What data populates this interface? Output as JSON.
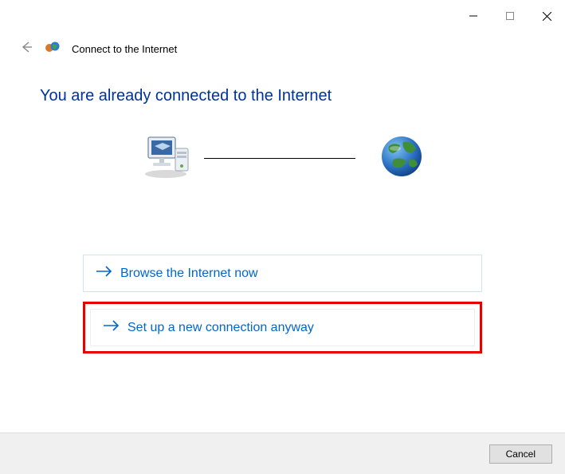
{
  "header": {
    "title": "Connect to the Internet"
  },
  "heading": "You are already connected to the Internet",
  "options": {
    "browse": "Browse the Internet now",
    "setup": "Set up a new connection anyway"
  },
  "footer": {
    "cancel": "Cancel"
  }
}
